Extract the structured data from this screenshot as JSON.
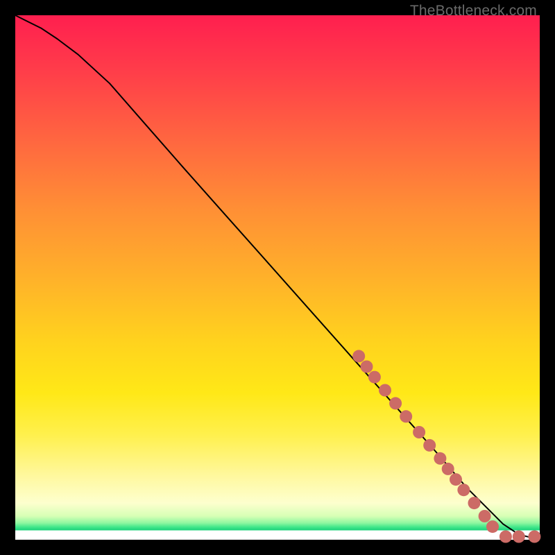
{
  "watermark": "TheBottleneck.com",
  "colors": {
    "dot": "#cc6b66",
    "curve": "#000000",
    "page_bg": "#000000"
  },
  "chart_data": {
    "type": "line",
    "title": "",
    "xlabel": "",
    "ylabel": "",
    "xlim": [
      0,
      100
    ],
    "ylim": [
      0,
      100
    ],
    "grid": false,
    "legend": false,
    "series": [
      {
        "name": "curve",
        "x": [
          0,
          2,
          5,
          8,
          12,
          18,
          25,
          32,
          40,
          48,
          56,
          64,
          72,
          80,
          86,
          90,
          93,
          96,
          98,
          100
        ],
        "y": [
          100,
          99,
          97.5,
          95.5,
          92.5,
          87,
          79,
          71,
          62,
          53,
          44,
          35,
          26,
          17,
          10,
          6,
          3,
          1,
          0.5,
          0.5
        ]
      }
    ],
    "points": [
      {
        "x": 65.5,
        "y": 35.0
      },
      {
        "x": 67.0,
        "y": 33.0
      },
      {
        "x": 68.5,
        "y": 31.0
      },
      {
        "x": 70.5,
        "y": 28.5
      },
      {
        "x": 72.5,
        "y": 26.0
      },
      {
        "x": 74.5,
        "y": 23.5
      },
      {
        "x": 77.0,
        "y": 20.5
      },
      {
        "x": 79.0,
        "y": 18.0
      },
      {
        "x": 81.0,
        "y": 15.5
      },
      {
        "x": 82.5,
        "y": 13.5
      },
      {
        "x": 84.0,
        "y": 11.5
      },
      {
        "x": 85.5,
        "y": 9.5
      },
      {
        "x": 87.5,
        "y": 7.0
      },
      {
        "x": 89.5,
        "y": 4.5
      },
      {
        "x": 91.0,
        "y": 2.5
      },
      {
        "x": 93.5,
        "y": 0.6
      },
      {
        "x": 96.0,
        "y": 0.6
      },
      {
        "x": 99.0,
        "y": 0.6
      }
    ]
  }
}
